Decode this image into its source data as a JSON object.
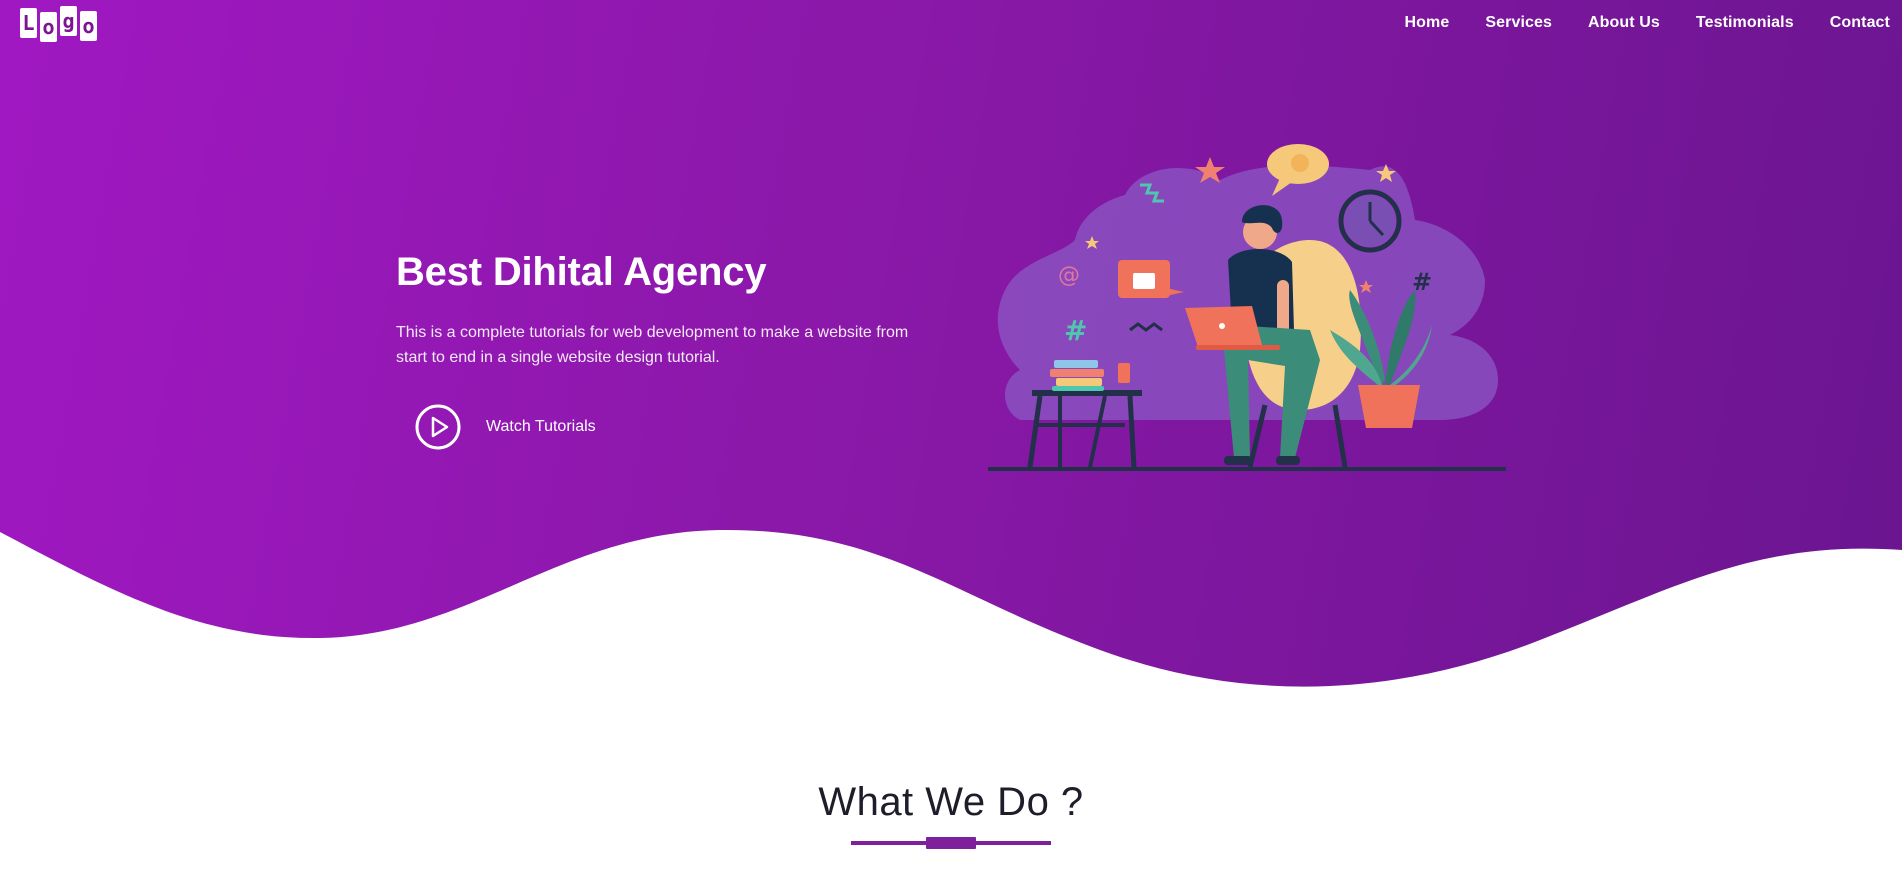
{
  "header": {
    "logo_letters": [
      "L",
      "o",
      "g",
      "o"
    ],
    "nav": [
      "Home",
      "Services",
      "About Us",
      "Testimonials",
      "Contact"
    ]
  },
  "hero": {
    "title": "Best Dihital Agency",
    "description": "This is a complete tutorials for web development to make a website from start to end in a single website design tutorial.",
    "cta_label": "Watch Tutorials",
    "cta_icon": "play-circle-icon",
    "illustration": "person-with-laptop-illustration"
  },
  "section": {
    "title": "What We Do ?"
  },
  "colors": {
    "gradient_start": "#a018c2",
    "gradient_end": "#6a1590",
    "accent": "#7e1f9c"
  }
}
